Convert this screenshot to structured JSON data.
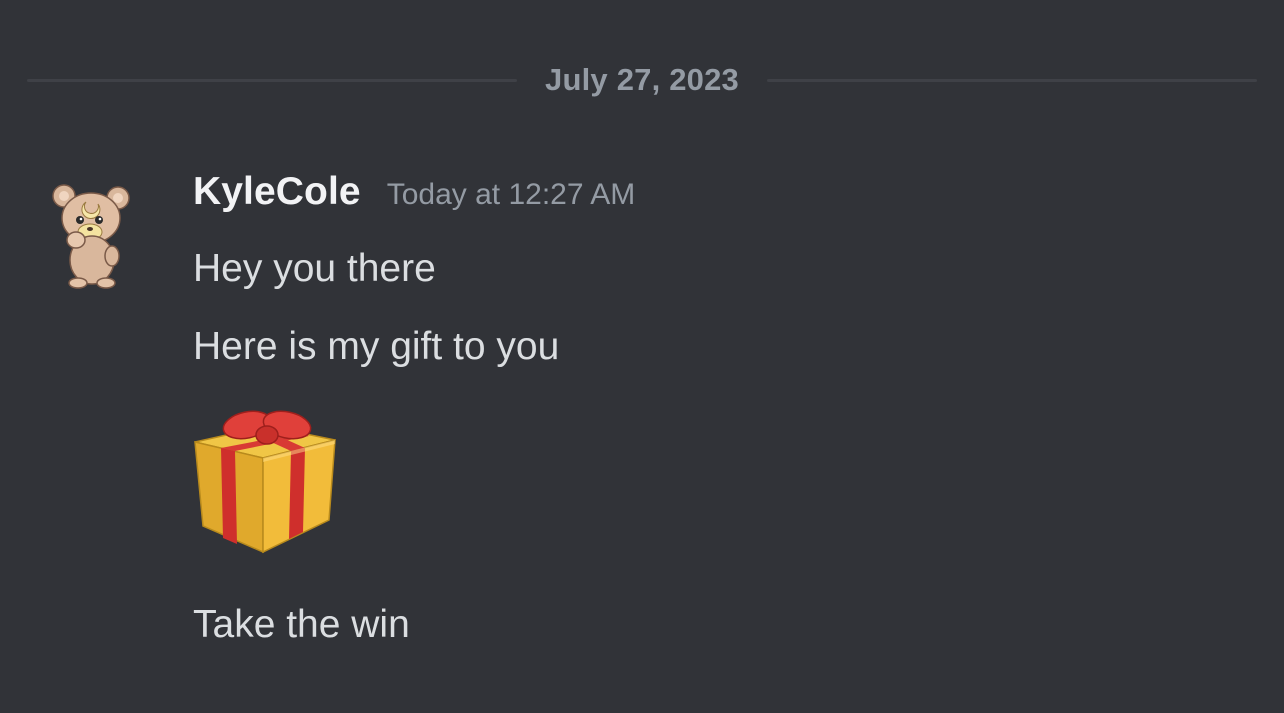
{
  "divider": {
    "date": "July 27, 2023"
  },
  "message": {
    "author": "KyleCole",
    "timestamp": "Today at 12:27 AM",
    "avatar_icon": "teddy-bear-avatar-icon",
    "lines": [
      "Hey you there",
      "Here is my gift to you",
      "Take the win"
    ],
    "emoji": "gift-emoji-icon"
  },
  "colors": {
    "background": "#313338",
    "divider_line": "#3f4147",
    "muted_text": "#949ba4",
    "username": "#f2f3f5",
    "message_text": "#dbdee1"
  }
}
